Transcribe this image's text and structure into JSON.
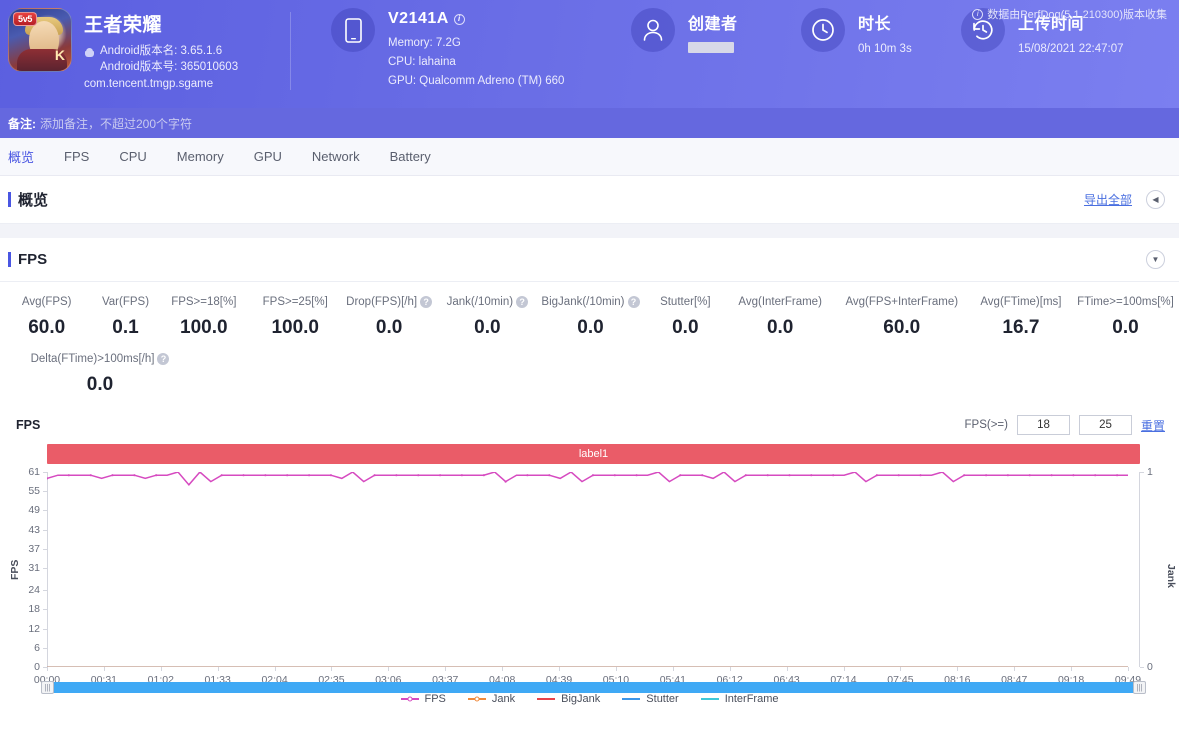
{
  "header": {
    "version_note": "数据由PerfDog(5.1.210300)版本收集",
    "app": {
      "name": "王者荣耀",
      "version_name": "Android版本名: 3.65.1.6",
      "version_code": "Android版本号: 365010603",
      "package": "com.tencent.tmgp.sgame",
      "icon_badge": "5v5",
      "icon_mark": "K"
    },
    "device": {
      "model": "V2141A",
      "memory": "Memory: 7.2G",
      "cpu": "CPU: lahaina",
      "gpu": "GPU: Qualcomm Adreno (TM) 660",
      "icon": "phone-icon"
    },
    "creator": {
      "title": "创建者",
      "value": ""
    },
    "duration": {
      "title": "时长",
      "value": "0h 10m 3s"
    },
    "upload": {
      "title": "上传时间",
      "value": "15/08/2021 22:47:07"
    },
    "remark_label": "备注:",
    "remark_placeholder": "添加备注，不超过200个字符"
  },
  "tabs": [
    {
      "label": "概览",
      "active": true
    },
    {
      "label": "FPS",
      "active": false
    },
    {
      "label": "CPU",
      "active": false
    },
    {
      "label": "Memory",
      "active": false
    },
    {
      "label": "GPU",
      "active": false
    },
    {
      "label": "Network",
      "active": false
    },
    {
      "label": "Battery",
      "active": false
    }
  ],
  "overview": {
    "title": "概览",
    "export_link": "导出全部",
    "collapse_icon": "chevron-left-icon"
  },
  "fps_panel": {
    "title": "FPS",
    "collapse_icon": "chevron-down-icon",
    "metrics_row1": [
      {
        "label": "Avg(FPS)",
        "value": "60.0",
        "help": false
      },
      {
        "label": "Var(FPS)",
        "value": "0.1",
        "help": false
      },
      {
        "label": "FPS>=18[%]",
        "value": "100.0",
        "help": false
      },
      {
        "label": "FPS>=25[%]",
        "value": "100.0",
        "help": false
      },
      {
        "label": "Drop(FPS)[/h]",
        "value": "0.0",
        "help": true
      },
      {
        "label": "Jank(/10min)",
        "value": "0.0",
        "help": true
      },
      {
        "label": "BigJank(/10min)",
        "value": "0.0",
        "help": true
      },
      {
        "label": "Stutter[%]",
        "value": "0.0",
        "help": false
      },
      {
        "label": "Avg(InterFrame)",
        "value": "0.0",
        "help": false
      },
      {
        "label": "Avg(FPS+InterFrame)",
        "value": "60.0",
        "help": false
      },
      {
        "label": "Avg(FTime)[ms]",
        "value": "16.7",
        "help": false
      },
      {
        "label": "FTime>=100ms[%]",
        "value": "0.0",
        "help": false
      }
    ],
    "metrics_row2": [
      {
        "label": "Delta(FTime)>100ms[/h]",
        "value": "0.0",
        "help": true
      }
    ],
    "chart_controls": {
      "axis_title": "FPS",
      "threshold_label": "FPS(>=)",
      "threshold_1": "18",
      "threshold_2": "25",
      "reset_label": "重置"
    },
    "label_band": "label1"
  },
  "chart_data": {
    "type": "line",
    "title": "FPS",
    "xlabel": "",
    "ylabel": "FPS",
    "ylabel_right": "Jank",
    "ylim": [
      0,
      61
    ],
    "ylim_right": [
      0,
      1
    ],
    "yticks": [
      61,
      55,
      49,
      43,
      37,
      31,
      24,
      18,
      12,
      6,
      0
    ],
    "yticks_right": [
      1,
      0
    ],
    "xticks": [
      "00:00",
      "00:31",
      "01:02",
      "01:33",
      "02:04",
      "02:35",
      "03:06",
      "03:37",
      "04:08",
      "04:39",
      "05:10",
      "05:41",
      "06:12",
      "06:43",
      "07:14",
      "07:45",
      "08:16",
      "08:47",
      "09:18",
      "09:49"
    ],
    "grid": false,
    "legend_position": "bottom",
    "band_label": "label1",
    "series": [
      {
        "name": "FPS",
        "color": "#d64ac0",
        "axis": "left",
        "values": [
          59,
          60,
          60,
          60,
          60,
          59,
          60,
          60,
          60,
          59,
          60,
          60,
          61,
          57,
          61,
          58,
          60,
          60,
          60,
          60,
          60,
          60,
          60,
          60,
          60,
          60,
          60,
          59,
          61,
          58,
          60,
          60,
          60,
          60,
          60,
          60,
          60,
          60,
          60,
          60,
          60,
          61,
          58,
          60,
          60,
          60,
          60,
          59,
          61,
          58,
          60,
          60,
          60,
          60,
          60,
          60,
          61,
          58,
          60,
          60,
          60,
          59,
          61,
          58,
          60,
          60,
          60,
          60,
          60,
          60,
          60,
          60,
          60,
          60,
          61,
          58,
          60,
          60,
          60,
          60,
          60,
          60,
          61,
          58,
          60,
          60,
          60,
          60,
          60,
          60,
          60,
          60,
          60,
          60,
          60,
          60,
          60,
          60,
          60,
          60
        ]
      },
      {
        "name": "Jank",
        "color": "#f08a3c",
        "axis": "right",
        "values": [
          0,
          0,
          0,
          0,
          0,
          0,
          0,
          0,
          0,
          0,
          0,
          0,
          0,
          0,
          0,
          0,
          0,
          0,
          0,
          0,
          0,
          0,
          0,
          0,
          0,
          0,
          0,
          0,
          0,
          0,
          0,
          0,
          0,
          0,
          0,
          0,
          0,
          0,
          0,
          0,
          0,
          0,
          0,
          0,
          0,
          0,
          0,
          0,
          0,
          0,
          0,
          0,
          0,
          0,
          0,
          0,
          0,
          0,
          0,
          0,
          0,
          0,
          0,
          0,
          0,
          0,
          0,
          0,
          0,
          0,
          0,
          0,
          0,
          0,
          0,
          0,
          0,
          0,
          0,
          0,
          0,
          0,
          0,
          0,
          0,
          0,
          0,
          0,
          0,
          0,
          0,
          0,
          0,
          0,
          0,
          0,
          0,
          0,
          0,
          0
        ]
      },
      {
        "name": "BigJank",
        "color": "#e8434a",
        "axis": "right",
        "values": []
      },
      {
        "name": "Stutter",
        "color": "#3d96e8",
        "axis": "right",
        "values": []
      },
      {
        "name": "InterFrame",
        "color": "#3fc8d8",
        "axis": "right",
        "values": []
      }
    ],
    "legend": [
      {
        "name": "FPS",
        "color": "#d64ac0",
        "marker": true
      },
      {
        "name": "Jank",
        "color": "#f08a3c",
        "marker": true
      },
      {
        "name": "BigJank",
        "color": "#e8434a",
        "marker": false
      },
      {
        "name": "Stutter",
        "color": "#3d96e8",
        "marker": false
      },
      {
        "name": "InterFrame",
        "color": "#3fc8d8",
        "marker": false
      }
    ]
  }
}
